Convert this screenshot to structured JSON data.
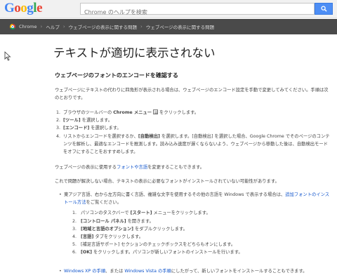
{
  "header": {
    "logo_letters": [
      {
        "ch": "G",
        "color": "#4285f4"
      },
      {
        "ch": "o",
        "color": "#ea4335"
      },
      {
        "ch": "o",
        "color": "#fbbc05"
      },
      {
        "ch": "g",
        "color": "#4285f4"
      },
      {
        "ch": "l",
        "color": "#34a853"
      },
      {
        "ch": "e",
        "color": "#ea4335"
      }
    ],
    "search_placeholder": "Chrome のヘルプを検索"
  },
  "breadcrumb": {
    "items": [
      "Chrome",
      "ヘルプ",
      "ウェブページの表示に関する問題",
      "ウェブページの表示に関する問題"
    ]
  },
  "article": {
    "title": "テキストが適切に表示されない",
    "section_title": "ウェブページのフォントのエンコードを確認する",
    "intro": "ウェブページにテキストの代わりに四角形が表示される場合は、ウェブページのエンコード設定を手動で変更してみてください。手順は次のとおりです。",
    "steps": [
      {
        "num": "1.",
        "pre": "ブラウザのツールバーの ",
        "bold": "Chrome メニュー",
        "post": " をクリックします。",
        "icon": "menu-icon"
      },
      {
        "num": "2.",
        "pre": "",
        "bold": "[ツール]",
        "post": " を選択します。"
      },
      {
        "num": "3.",
        "pre": "",
        "bold": "[エンコード]",
        "post": " を選択します。"
      },
      {
        "num": "4.",
        "pre": "リストからエンコードを選択するか、",
        "bold": "[自動検出]",
        "post": " を選択します。[自動検出] を選択した場合、Google Chrome でそのページのコンテンツを解析し、最適なエンコードを推測します。読み込み速度が遅くならないよう、ウェブページから移動した後は、自動検出モードをオフにすることをおすすめします。"
      }
    ],
    "font_change": {
      "pre": "ウェブページの表示に使用する",
      "link1": "フォントや言語",
      "post": "を変更することもできます。"
    },
    "no_fix": "これで問題が解決しない場合、テキストの表示に必要なフォントがインストールされていない可能性があります。",
    "bullet1": {
      "pre": "東アジア言語、右から左方向に書く言語、複雑な文字を使用するその他の言語を Windows で表示する場合は、",
      "link": "追加フォントのインストール方法",
      "post": "をご覧ください。"
    },
    "substeps": [
      {
        "num": "1.",
        "pre": "パソコンのタスクバーで ",
        "bold": "[スタート]",
        "post": " メニューをクリックします。"
      },
      {
        "num": "2.",
        "pre": "",
        "bold": "[コントロール パネル]",
        "post": " を開きます。"
      },
      {
        "num": "3.",
        "pre": "",
        "bold": "[地域と言語のオプション]",
        "post": " をダブルクリックします。"
      },
      {
        "num": "4.",
        "pre": "",
        "bold": "[言語]",
        "post": " タブをクリックします。"
      },
      {
        "num": "5.",
        "pre": "[補足言語サポート] セクションのチェックボックスをどちらもオンにします。",
        "bold": "",
        "post": ""
      },
      {
        "num": "6.",
        "pre": "",
        "bold": "[OK]",
        "post": " をクリックします。パソコンが新しいフォントのインストールを行います。"
      }
    ],
    "bullet2": {
      "link1": "Windows XP の手順",
      "mid": "、または ",
      "link2": "Windows Vista の手順",
      "post": "にしたがって、新しいフォントをインストールすることもできます。"
    }
  }
}
